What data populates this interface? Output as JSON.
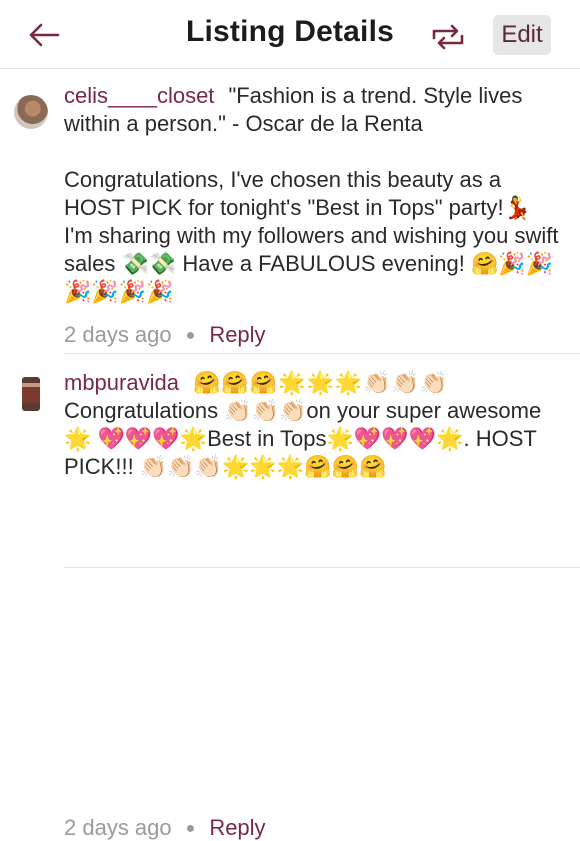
{
  "header": {
    "title": "Listing Details",
    "edit_label": "Edit"
  },
  "comments": [
    {
      "username": "celis____closet",
      "lines": [
        "\"Fashion is a trend. Style lives within a person.\" - Oscar de la Renta",
        "Congratulations, I've chosen this beauty as a HOST PICK for tonight's \"Best in Tops\" party!💃 I'm sharing with my followers and wishing you swift sales 💸💸 Have a FABULOUS evening! 🤗🎉🎉🎉🎉🎉🎉"
      ],
      "time": "2 days ago",
      "reply_label": "Reply"
    },
    {
      "username": "mbpuravida",
      "text_emojis": "🤗🤗🤗🌟🌟🌟👏🏻👏🏻👏🏻",
      "text": "Congratulations 👏🏻👏🏻👏🏻on your super awesome🌟 💖💖💖🌟Best in Tops🌟💖💖💖🌟. HOST PICK!!! 👏🏻👏🏻👏🏻🌟🌟🌟🤗🤗🤗",
      "time": "2 days ago",
      "reply_label": "Reply"
    }
  ],
  "icons": {
    "back": "back-arrow-icon",
    "share": "share-repost-icon"
  },
  "colors": {
    "accent": "#7a2a3f",
    "muted": "#9a9a9a",
    "edit_bg": "#e6e6e6"
  }
}
